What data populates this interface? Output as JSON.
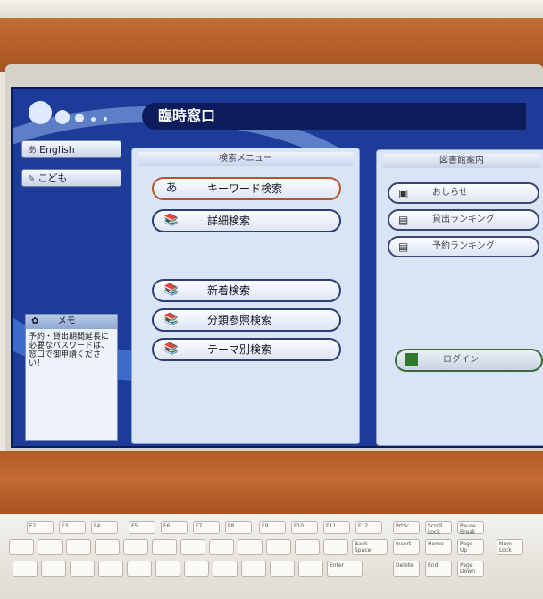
{
  "screen": {
    "title": "臨時窓口",
    "side": {
      "english_label": "English",
      "kids_label": "こども"
    },
    "memo": {
      "header": "メモ",
      "text": "予約・貸出期間延長に必要なパスワードは、窓口で御申請ください！"
    },
    "search_menu": {
      "header": "検索メニュー",
      "items": [
        {
          "label": "キーワード検索",
          "icon": "keyword-search-icon"
        },
        {
          "label": "詳細検索",
          "icon": "detail-search-icon"
        },
        {
          "label": "新着検索",
          "icon": "new-arrivals-icon"
        },
        {
          "label": "分類参照検索",
          "icon": "category-search-icon"
        },
        {
          "label": "テーマ別検索",
          "icon": "theme-search-icon"
        }
      ]
    },
    "library_guide": {
      "header": "図書館案内",
      "items": [
        {
          "label": "おしらせ",
          "icon": "notice-icon"
        },
        {
          "label": "貸出ランキング",
          "icon": "loan-ranking-icon"
        },
        {
          "label": "予約ランキング",
          "icon": "reserve-ranking-icon"
        }
      ],
      "login_label": "ログイン"
    }
  },
  "keyboard": {
    "keys": [
      "F2",
      "F3",
      "F4",
      "F5",
      "F6",
      "F7",
      "F8",
      "F9",
      "F10",
      "F11",
      "F12",
      "PrtSc",
      "Scroll Lock",
      "Pause Break",
      "Back Space",
      "Insert",
      "Home",
      "Page Up",
      "Num Lock",
      "Enter",
      "Delete",
      "End",
      "Page Down"
    ]
  }
}
